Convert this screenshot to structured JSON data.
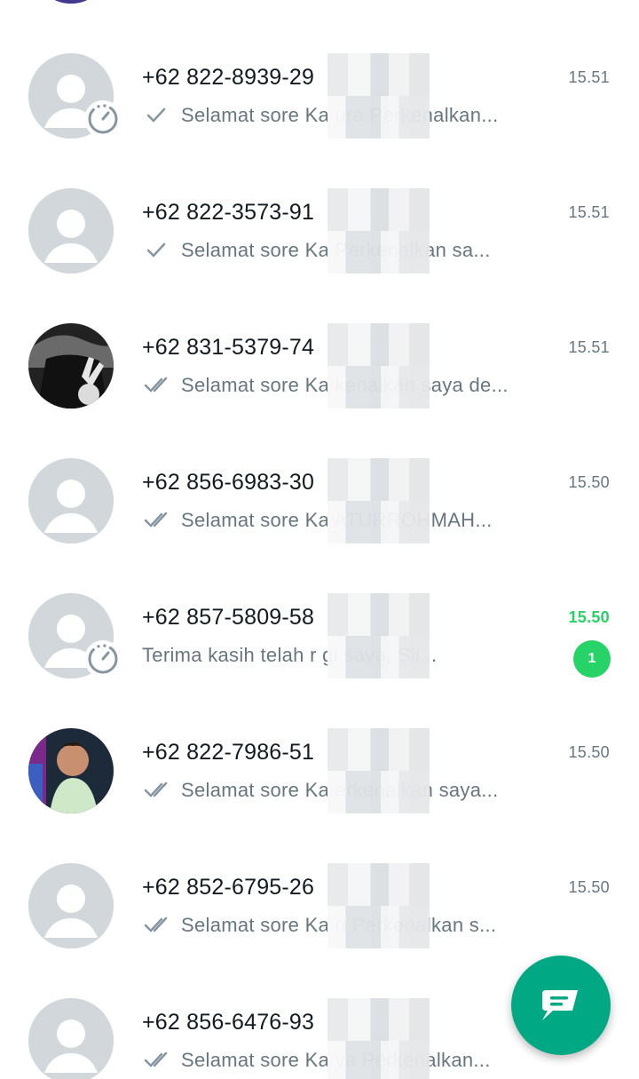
{
  "chats": [
    {
      "name": "+62 822-8939-29",
      "preview": "Selamat sore Ka ura  Perkenalkan...",
      "time": "15.51",
      "tick": "single",
      "scheduled": true,
      "unread": "",
      "avatar": "default"
    },
    {
      "name": "+62 822-3573-91",
      "preview": "Selamat sore Ka  Perkenalkan sa...",
      "time": "15.51",
      "tick": "single",
      "scheduled": false,
      "unread": "",
      "avatar": "default"
    },
    {
      "name": "+62 831-5379-74",
      "preview": "Selamat sore Ka kenalkan saya de...",
      "time": "15.51",
      "tick": "double",
      "scheduled": false,
      "unread": "",
      "avatar": "photo-dark"
    },
    {
      "name": "+62 856-6983-30",
      "preview": "Selamat sore Ka ATURROHMAH...",
      "time": "15.50",
      "tick": "double",
      "scheduled": false,
      "unread": "",
      "avatar": "default"
    },
    {
      "name": "+62 857-5809-58",
      "preview": "Terima kasih telah r gi saya, Sil...",
      "time": "15.50",
      "tick": "none",
      "scheduled": true,
      "unread": "1",
      "avatar": "default"
    },
    {
      "name": "+62 822-7986-51",
      "preview": "Selamat sore Ka erkenalkan saya...",
      "time": "15.50",
      "tick": "double",
      "scheduled": false,
      "unread": "",
      "avatar": "photo-child"
    },
    {
      "name": "+62 852-6795-26",
      "preview": "Selamat sore Ka ri  Perkenalkan s...",
      "time": "15.50",
      "tick": "double",
      "scheduled": false,
      "unread": "",
      "avatar": "default"
    },
    {
      "name": "+62 856-6476-93",
      "preview": "Selamat sore Ka ya  Perkenalkan...",
      "time": "",
      "tick": "double",
      "scheduled": false,
      "unread": "",
      "avatar": "default"
    }
  ],
  "colors": {
    "accent": "#00a884",
    "unread": "#25d366",
    "muted": "#667781",
    "tick_read": "#8696a0"
  },
  "fab": {
    "icon": "new-chat-icon"
  }
}
